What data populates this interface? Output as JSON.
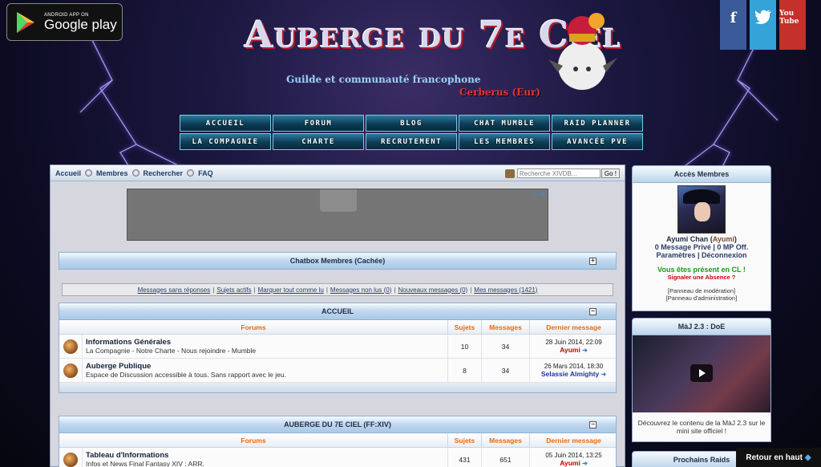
{
  "google_play": {
    "small": "ANDROID APP ON",
    "big": "Google play"
  },
  "social": {
    "facebook": "f",
    "youtube": "You Tube"
  },
  "logo": {
    "title": "Auberge du 7e Ciel",
    "subtitle": "Guilde et communauté francophone",
    "server": "Cerberus (Eur)"
  },
  "nav": [
    "Accueil",
    "Forum",
    "Blog",
    "Chat Mumble",
    "Raid Planner",
    "La Compagnie",
    "Charte",
    "Recrutement",
    "Les Membres",
    "Avancée PvE"
  ],
  "toolbar": {
    "items": [
      "Accueil",
      "Membres",
      "Rechercher",
      "FAQ"
    ],
    "search_placeholder": "Recherche XIVDB...",
    "search_button": "Go !"
  },
  "chatbox": {
    "title": "Chatbox Membres (Cachée)"
  },
  "quick_links": [
    "Messages sans réponses",
    "Sujets actifs",
    "Marquer tout comme lu",
    "Messages non lus (0)",
    "Nouveaux messages (0)",
    "Mes messages (1421)"
  ],
  "sections": [
    {
      "title": "ACCUEIL",
      "headers": [
        "Forums",
        "Sujets",
        "Messages",
        "Dernier message"
      ],
      "rows": [
        {
          "name": "Informations Générales",
          "desc": "La Compagnie - Notre Charte - Nous rejoindre - Mumble",
          "topics": "10",
          "posts": "34",
          "last_date": "28 Juin 2014, 22:09",
          "last_user": "Ayumi"
        },
        {
          "name": "Auberge Publique",
          "desc": "Espace de Discussion accessible à tous. Sans rapport avec le jeu.",
          "topics": "8",
          "posts": "34",
          "last_date": "26 Mars 2014, 18:30",
          "last_user": "Selassie Almighty"
        }
      ]
    },
    {
      "title": "AUBERGE DU 7E CIEL (FF:XIV)",
      "headers": [
        "Forums",
        "Sujets",
        "Messages",
        "Dernier message"
      ],
      "rows": [
        {
          "name": "Tableau d'Informations",
          "desc": "Infos et News Final Fantasy XIV : ARR.",
          "topics": "431",
          "posts": "651",
          "last_date": "05 Juin 2014, 13:25",
          "last_user": "Ayumi"
        }
      ]
    }
  ],
  "member_panel": {
    "title": "Accès Membres",
    "username": "Ayumi Chan",
    "username_alias": "Ayumi",
    "messages": "0 Message Privé",
    "mp_off": "0 MP Off.",
    "params": "Paramètres",
    "logout": "Déconnexion",
    "online": "Vous êtes présent en CL !",
    "absence": "Signaler une Absence ?",
    "moderation": "[Panneau de modération]",
    "administration": "[Panneau d'administration]"
  },
  "maj_panel": {
    "title": "MàJ 2.3 : DoE",
    "text": "Découvrez le contenu de la MàJ 2.3 sur le mini site officiel !"
  },
  "raids_panel": {
    "title": "Prochains Raids"
  },
  "back_to_top": "Retour en haut",
  "colors": {
    "nav_top": "#2c7a9c",
    "forum_header": "#e46b12",
    "online": "#12a012"
  }
}
